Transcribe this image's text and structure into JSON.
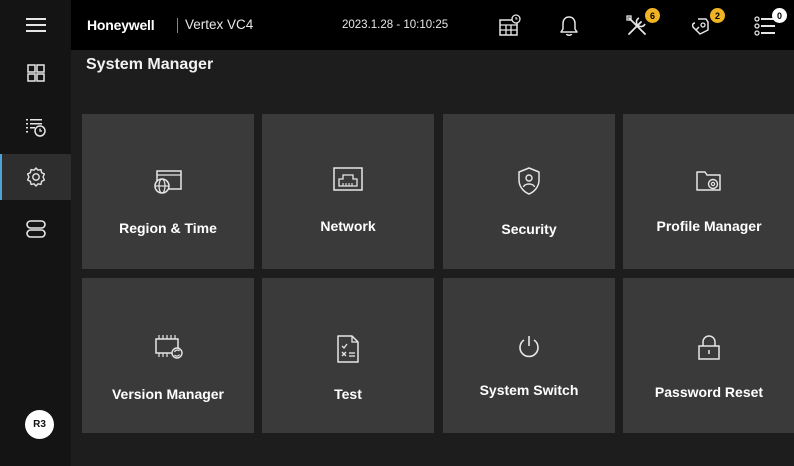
{
  "header": {
    "brand": "Honeywell",
    "product": "Vertex VC4",
    "datetime": "2023.1.28 - 10:10:25",
    "icons": [
      "calendar-clock-icon",
      "bell-icon",
      "tools-icon",
      "maintenance-icon",
      "list-icon"
    ],
    "badges": {
      "tools": "6",
      "maintenance": "2",
      "list": "0"
    }
  },
  "sidebar": {
    "items": [
      {
        "icon": "menu-icon"
      },
      {
        "icon": "dashboard-icon"
      },
      {
        "icon": "history-list-icon"
      },
      {
        "icon": "settings-icon",
        "active": true
      },
      {
        "icon": "storage-icon"
      }
    ],
    "user": "R3"
  },
  "main": {
    "title": "System Manager",
    "tiles": [
      {
        "label": "Region & Time",
        "icon": "globe-window-icon"
      },
      {
        "label": "Network",
        "icon": "network-port-icon"
      },
      {
        "label": "Security",
        "icon": "shield-user-icon"
      },
      {
        "label": "Profile Manager",
        "icon": "folder-gear-icon"
      },
      {
        "label": "Version Manager",
        "icon": "chip-refresh-icon"
      },
      {
        "label": "Test",
        "icon": "test-sheet-icon"
      },
      {
        "label": "System Switch",
        "icon": "power-icon"
      },
      {
        "label": "Password Reset",
        "icon": "lock-icon"
      }
    ]
  },
  "colors": {
    "background": "#1d1d1d",
    "header": "#000000",
    "rail": "#141414",
    "tile": "#3a3a3a",
    "badge": "#f0b323",
    "accent": "#4ba3d8"
  }
}
